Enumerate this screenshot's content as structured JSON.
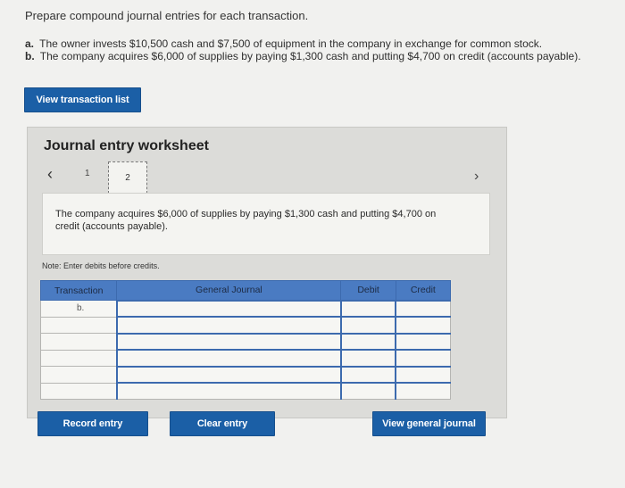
{
  "instructions": {
    "title": "Prepare compound journal entries for each transaction.",
    "items": [
      {
        "letter": "a.",
        "text": "The owner invests $10,500 cash and $7,500 of equipment in the company in exchange for common stock."
      },
      {
        "letter": "b.",
        "text": "The company acquires $6,000 of supplies by paying $1,300 cash and putting $4,700 on credit (accounts payable)."
      }
    ]
  },
  "buttons": {
    "view_transaction_list": "View transaction list",
    "record_entry": "Record entry",
    "clear_entry": "Clear entry",
    "view_general_journal": "View general journal"
  },
  "worksheet": {
    "title": "Journal entry worksheet",
    "tabs": [
      "1",
      "2"
    ],
    "active_tab": "2",
    "description": "The company acquires $6,000 of supplies by paying $1,300 cash and putting $4,700 on credit (accounts payable).",
    "note": "Note: Enter debits before credits."
  },
  "table": {
    "headers": {
      "transaction": "Transaction",
      "general_journal": "General Journal",
      "debit": "Debit",
      "credit": "Credit"
    },
    "transaction_label": "b.",
    "row_count": 6
  }
}
